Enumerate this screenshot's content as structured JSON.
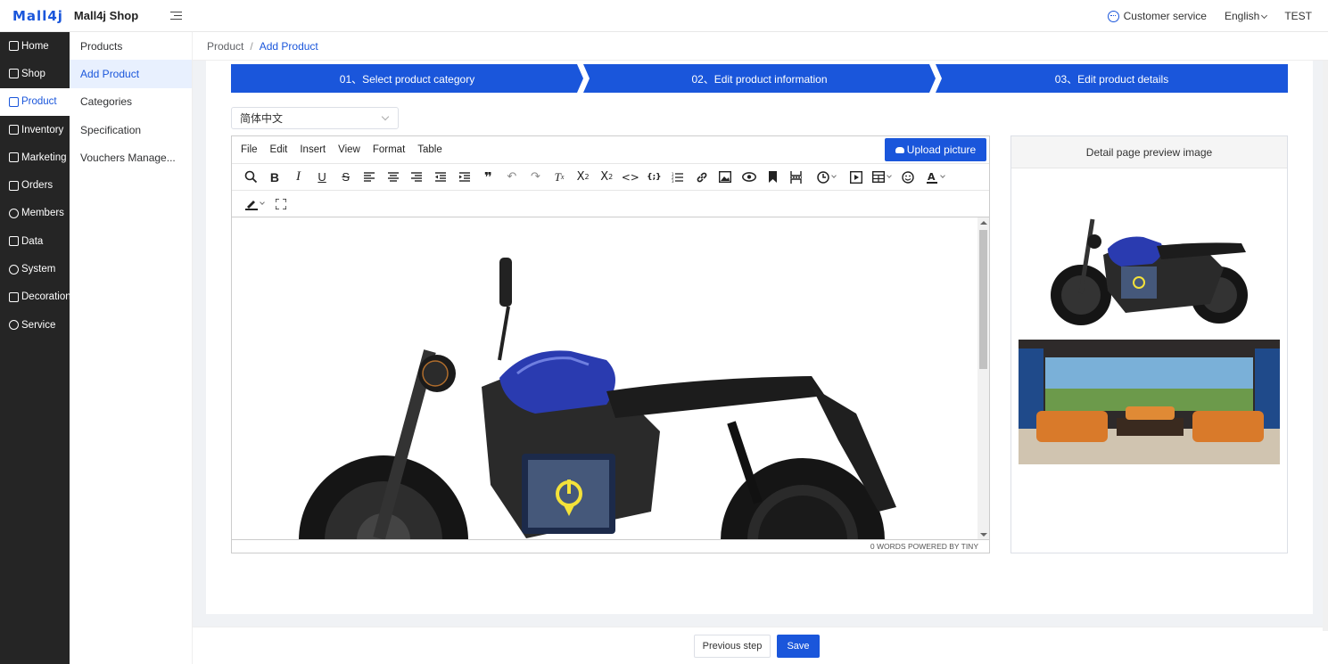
{
  "header": {
    "logo": "Mall4j",
    "shop_name": "Mall4j Shop",
    "customer_service": "Customer service",
    "language": "English",
    "user": "TEST"
  },
  "sidebar": {
    "items": [
      {
        "label": "Home",
        "icon": "home-icon"
      },
      {
        "label": "Shop",
        "icon": "shop-icon"
      },
      {
        "label": "Product",
        "icon": "product-icon"
      },
      {
        "label": "Inventory",
        "icon": "inventory-icon"
      },
      {
        "label": "Marketing",
        "icon": "gift-icon"
      },
      {
        "label": "Orders",
        "icon": "orders-icon"
      },
      {
        "label": "Members",
        "icon": "members-icon"
      },
      {
        "label": "Data",
        "icon": "data-icon"
      },
      {
        "label": "System",
        "icon": "gear-icon"
      },
      {
        "label": "Decoration",
        "icon": "decoration-icon"
      },
      {
        "label": "Service",
        "icon": "chat-icon"
      }
    ],
    "active_index": 2
  },
  "submenu": {
    "items": [
      "Products",
      "Add Product",
      "Categories",
      "Specification",
      "Vouchers Manage..."
    ],
    "active_index": 1
  },
  "breadcrumb": {
    "parent": "Product",
    "separator": "/",
    "current": "Add Product"
  },
  "steps": [
    "01、Select product category",
    "02、Edit product information",
    "03、Edit product details"
  ],
  "language_select": {
    "value": "简体中文"
  },
  "editor": {
    "menus": [
      "File",
      "Edit",
      "Insert",
      "View",
      "Format",
      "Table"
    ],
    "upload_label": "Upload picture",
    "status": "0 WORDS  POWERED BY TINY"
  },
  "preview": {
    "title": "Detail page preview image"
  },
  "footer": {
    "prev_label": "Previous step",
    "save_label": "Save"
  },
  "colors": {
    "accent": "#1a56db",
    "sidebar_bg": "#252525"
  }
}
